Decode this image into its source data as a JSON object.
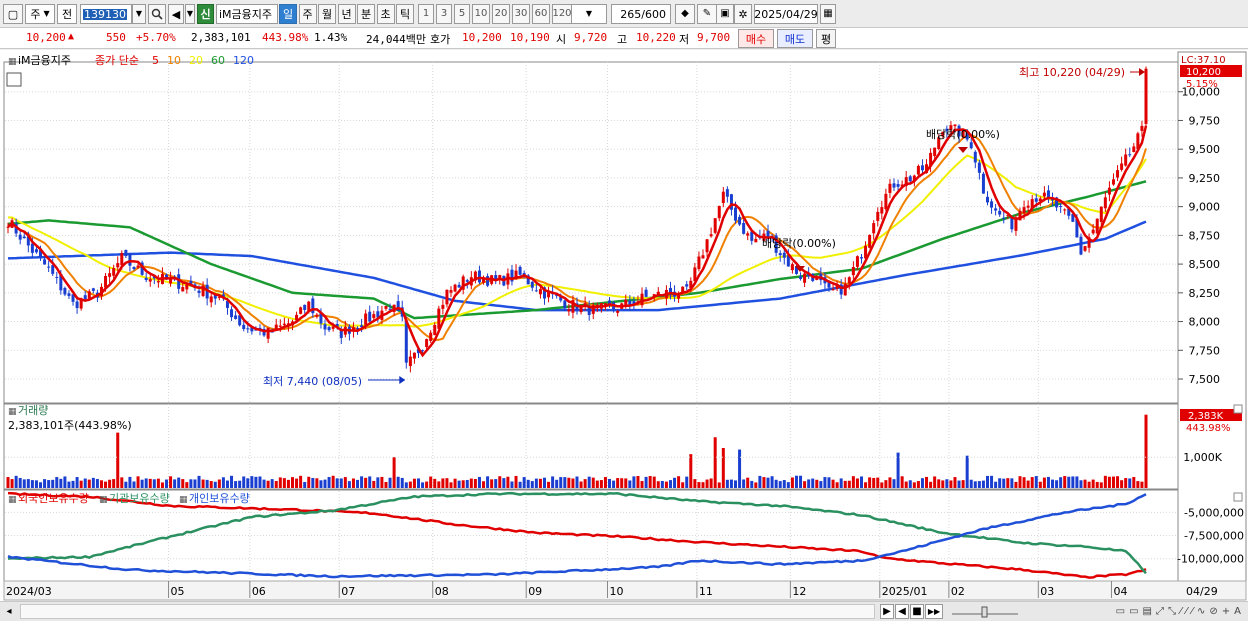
{
  "toolbar": {
    "type_select": "주",
    "market_select": "전",
    "code": "139130",
    "shin_label": "신",
    "stock_name": "iM금융지주",
    "periods": [
      "일",
      "주",
      "월",
      "년",
      "분",
      "초",
      "틱"
    ],
    "active_period": "일",
    "intervals": [
      "1",
      "3",
      "5",
      "10",
      "20",
      "30",
      "60",
      "120"
    ],
    "count": "265",
    "count_total": "/600",
    "date": "2025/04/29"
  },
  "quote": {
    "price": "10,200",
    "up_arrow": "▲",
    "change": "550",
    "change_pct": "+5.70%",
    "volume": "2,383,101",
    "volume_ratio": "443.98%",
    "turnover": "1.43%",
    "amount": "24,044백만",
    "hoga_label": "호가",
    "ask": "10,200",
    "bid": "10,190",
    "open_label": "시",
    "open": "9,720",
    "high_label": "고",
    "high": "10,220",
    "low_label": "저",
    "low": "9,700",
    "buy_label": "매수",
    "sell_label": "매도",
    "eval_label": "평"
  },
  "colors": {
    "up": "#e00000",
    "down": "#1a3fd0",
    "ma5": "#e00000",
    "ma10": "#f08000",
    "ma20": "#f0f000",
    "ma60": "#1a9a30",
    "ma120": "#2050e0",
    "foreign": "#e00000",
    "institution": "#2a9060",
    "individual": "#2050d8"
  },
  "chart_data": [
    {
      "type": "candlestick",
      "title": "iM금융지주",
      "legend": {
        "label": "종가 단순",
        "periods": [
          "5",
          "10",
          "20",
          "60",
          "120"
        ]
      },
      "y_ticks": [
        "10,000",
        "9,750",
        "9,500",
        "9,250",
        "9,000",
        "8,750",
        "8,500",
        "8,250",
        "8,000",
        "7,750",
        "7,500"
      ],
      "ylim": [
        7300,
        10250
      ],
      "x_ticks": [
        "2024/03",
        "05",
        "06",
        "07",
        "08",
        "09",
        "10",
        "11",
        "12",
        "2025/01",
        "02",
        "03",
        "04",
        "04/29"
      ],
      "last_price_tag": "10,200",
      "last_pct_tag": "5.15%",
      "lc_label": "LC:37.10",
      "annotations": {
        "high": "최고 10,220 (04/29)",
        "low": "최저 7,440 (08/05)",
        "ex_div_1": "배당락(0.00%)",
        "ex_div_2": "배당락(0.00%)"
      },
      "close_anchors": [
        [
          0,
          8880
        ],
        [
          4,
          8700
        ],
        [
          10,
          8450
        ],
        [
          16,
          8150
        ],
        [
          22,
          8250
        ],
        [
          28,
          8550
        ],
        [
          34,
          8400
        ],
        [
          40,
          8350
        ],
        [
          46,
          8300
        ],
        [
          52,
          8200
        ],
        [
          58,
          7950
        ],
        [
          64,
          7900
        ],
        [
          70,
          8000
        ],
        [
          74,
          8150
        ],
        [
          78,
          7950
        ],
        [
          82,
          7900
        ],
        [
          86,
          7980
        ],
        [
          90,
          8050
        ],
        [
          94,
          8150
        ],
        [
          97,
          8000
        ],
        [
          98,
          7600
        ],
        [
          102,
          7800
        ],
        [
          108,
          8250
        ],
        [
          114,
          8400
        ],
        [
          120,
          8350
        ],
        [
          126,
          8400
        ],
        [
          132,
          8250
        ],
        [
          138,
          8150
        ],
        [
          144,
          8100
        ],
        [
          150,
          8120
        ],
        [
          156,
          8200
        ],
        [
          162,
          8250
        ],
        [
          167,
          8250
        ],
        [
          172,
          8700
        ],
        [
          176,
          9100
        ],
        [
          180,
          8850
        ],
        [
          183,
          8700
        ],
        [
          187,
          8750
        ],
        [
          191,
          8550
        ],
        [
          195,
          8400
        ],
        [
          198,
          8400
        ],
        [
          202,
          8250
        ],
        [
          206,
          8300
        ],
        [
          210,
          8600
        ],
        [
          214,
          9000
        ],
        [
          218,
          9200
        ],
        [
          222,
          9250
        ],
        [
          226,
          9350
        ],
        [
          230,
          9700
        ],
        [
          234,
          9650
        ],
        [
          237,
          9550
        ],
        [
          240,
          9150
        ],
        [
          243,
          8950
        ],
        [
          247,
          8850
        ],
        [
          250,
          9050
        ],
        [
          254,
          9100
        ],
        [
          258,
          9000
        ],
        [
          262,
          8850
        ],
        [
          264,
          8600
        ],
        [
          267,
          8800
        ],
        [
          271,
          9150
        ],
        [
          275,
          9400
        ],
        [
          279,
          9650
        ],
        [
          280,
          10200
        ]
      ],
      "ma_anchors": {
        "ma20": [
          [
            0,
            8950
          ],
          [
            40,
            8300
          ],
          [
            80,
            7950
          ],
          [
            100,
            7950
          ],
          [
            130,
            8300
          ],
          [
            170,
            8200
          ],
          [
            200,
            8550
          ],
          [
            225,
            9100
          ],
          [
            236,
            9450
          ],
          [
            248,
            9100
          ],
          [
            262,
            9050
          ],
          [
            270,
            8950
          ],
          [
            280,
            9550
          ]
        ],
        "ma60": [
          [
            0,
            8850
          ],
          [
            10,
            8880
          ],
          [
            30,
            8820
          ],
          [
            50,
            8500
          ],
          [
            70,
            8250
          ],
          [
            90,
            8200
          ],
          [
            100,
            8030
          ],
          [
            130,
            8100
          ],
          [
            170,
            8250
          ],
          [
            190,
            8370
          ],
          [
            210,
            8460
          ],
          [
            230,
            8720
          ],
          [
            250,
            8950
          ],
          [
            265,
            9080
          ],
          [
            280,
            9220
          ]
        ],
        "ma120": [
          [
            0,
            8550
          ],
          [
            40,
            8600
          ],
          [
            60,
            8570
          ],
          [
            90,
            8380
          ],
          [
            110,
            8180
          ],
          [
            130,
            8100
          ],
          [
            160,
            8100
          ],
          [
            190,
            8200
          ],
          [
            220,
            8400
          ],
          [
            250,
            8580
          ],
          [
            270,
            8720
          ],
          [
            280,
            8870
          ]
        ]
      }
    },
    {
      "type": "bar",
      "title": "거래량",
      "value_label": "2,383,101주(443.98%)",
      "y_ticks": [
        "1,000K"
      ],
      "last_tag": "2,383K",
      "last_pct": "443.98%",
      "last_value_k": 2383,
      "spike_k": [
        [
          27,
          1800
        ],
        [
          95,
          1000
        ],
        [
          168,
          1100
        ],
        [
          174,
          1650
        ],
        [
          176,
          1300
        ],
        [
          180,
          1250
        ],
        [
          219,
          1150
        ],
        [
          236,
          1050
        ],
        [
          280,
          2383
        ]
      ]
    },
    {
      "type": "line",
      "series": [
        {
          "name": "외국인보유수량",
          "key": "foreign",
          "anchors": [
            [
              0,
              -3000000
            ],
            [
              20,
              -3300000
            ],
            [
              40,
              -4300000
            ],
            [
              70,
              -4700000
            ],
            [
              90,
              -5100000
            ],
            [
              110,
              -6300000
            ],
            [
              130,
              -7200000
            ],
            [
              150,
              -7600000
            ],
            [
              170,
              -8200000
            ],
            [
              190,
              -8700000
            ],
            [
              210,
              -9200000
            ],
            [
              215,
              -9900000
            ],
            [
              230,
              -10500000
            ],
            [
              250,
              -11200000
            ],
            [
              265,
              -12000000
            ],
            [
              275,
              -11700000
            ],
            [
              280,
              -11200000
            ]
          ]
        },
        {
          "name": "기관보유수량",
          "key": "institution",
          "anchors": [
            [
              0,
              -10000000
            ],
            [
              20,
              -9800000
            ],
            [
              40,
              -7600000
            ],
            [
              60,
              -5500000
            ],
            [
              80,
              -4800000
            ],
            [
              100,
              -3300000
            ],
            [
              120,
              -3000000
            ],
            [
              150,
              -3000000
            ],
            [
              170,
              -3800000
            ],
            [
              190,
              -4300000
            ],
            [
              210,
              -5300000
            ],
            [
              230,
              -7200000
            ],
            [
              250,
              -8300000
            ],
            [
              265,
              -8700000
            ],
            [
              275,
              -9200000
            ],
            [
              280,
              -11500000
            ]
          ]
        },
        {
          "name": "개인보유수량",
          "key": "individual",
          "anchors": [
            [
              0,
              -9800000
            ],
            [
              30,
              -11200000
            ],
            [
              80,
              -11900000
            ],
            [
              120,
              -11700000
            ],
            [
              160,
              -10900000
            ],
            [
              170,
              -10200000
            ],
            [
              190,
              -10600000
            ],
            [
              210,
              -10200000
            ],
            [
              220,
              -9200000
            ],
            [
              240,
              -6800000
            ],
            [
              260,
              -5000000
            ],
            [
              275,
              -4100000
            ],
            [
              280,
              -3000000
            ]
          ]
        }
      ],
      "y_ticks": [
        "-5,000,000",
        "-7,500,000",
        "-10,000,000"
      ],
      "ylim": [
        -12300000,
        -2800000
      ]
    }
  ],
  "bottombar": {
    "play_labels": [
      "▶",
      "◀",
      "■",
      "▶▶"
    ]
  }
}
